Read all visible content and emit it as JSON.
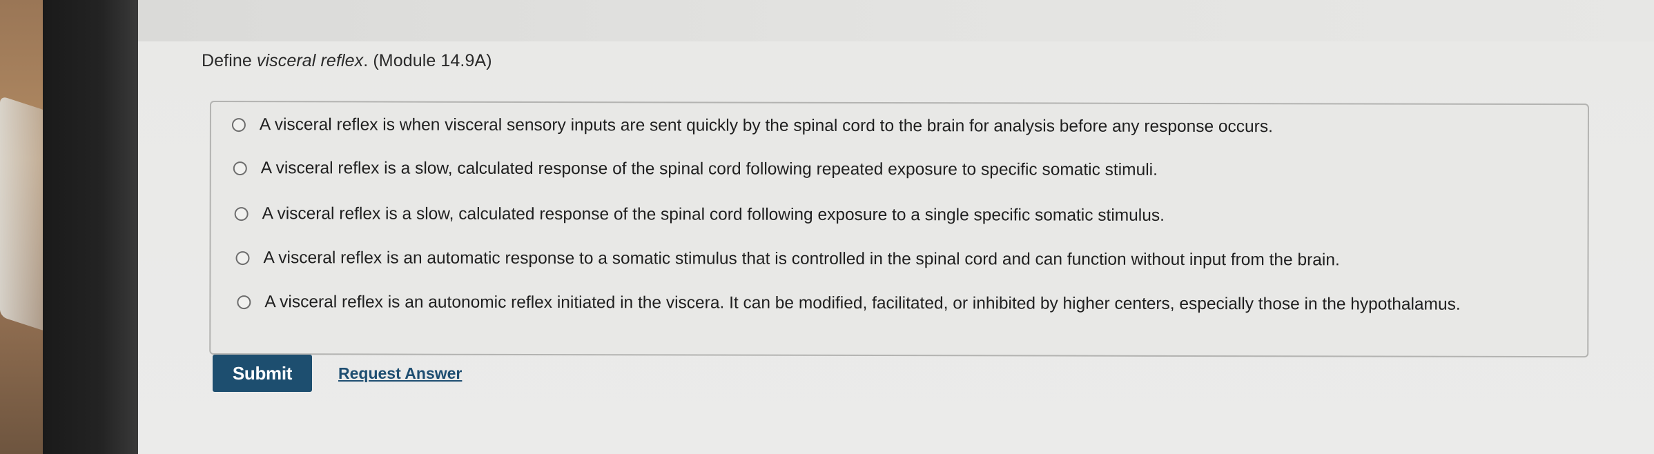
{
  "question": {
    "prefix": "Define ",
    "term": "visceral reflex",
    "suffix": ". (Module 14.9A)"
  },
  "options": [
    {
      "label": "A visceral reflex is when visceral sensory inputs are sent quickly by the spinal cord to the brain for analysis before any response occurs.",
      "selected": false
    },
    {
      "label": "A visceral reflex is a slow, calculated response of the spinal cord following repeated exposure to specific somatic stimuli.",
      "selected": false
    },
    {
      "label": "A visceral reflex is a slow, calculated response of the spinal cord following exposure to a single specific somatic stimulus.",
      "selected": false
    },
    {
      "label": "A visceral reflex is an automatic response to a somatic stimulus that is controlled in the spinal cord and can function without input from the brain.",
      "selected": false
    },
    {
      "label": "A visceral reflex is an autonomic reflex initiated in the viscera. It can be modified, facilitated, or inhibited by higher centers, especially those in the hypothalamus.",
      "selected": false
    }
  ],
  "actions": {
    "submit_label": "Submit",
    "request_answer_label": "Request Answer"
  },
  "colors": {
    "submit_bg": "#1d4e6f",
    "link": "#1e4e71"
  }
}
